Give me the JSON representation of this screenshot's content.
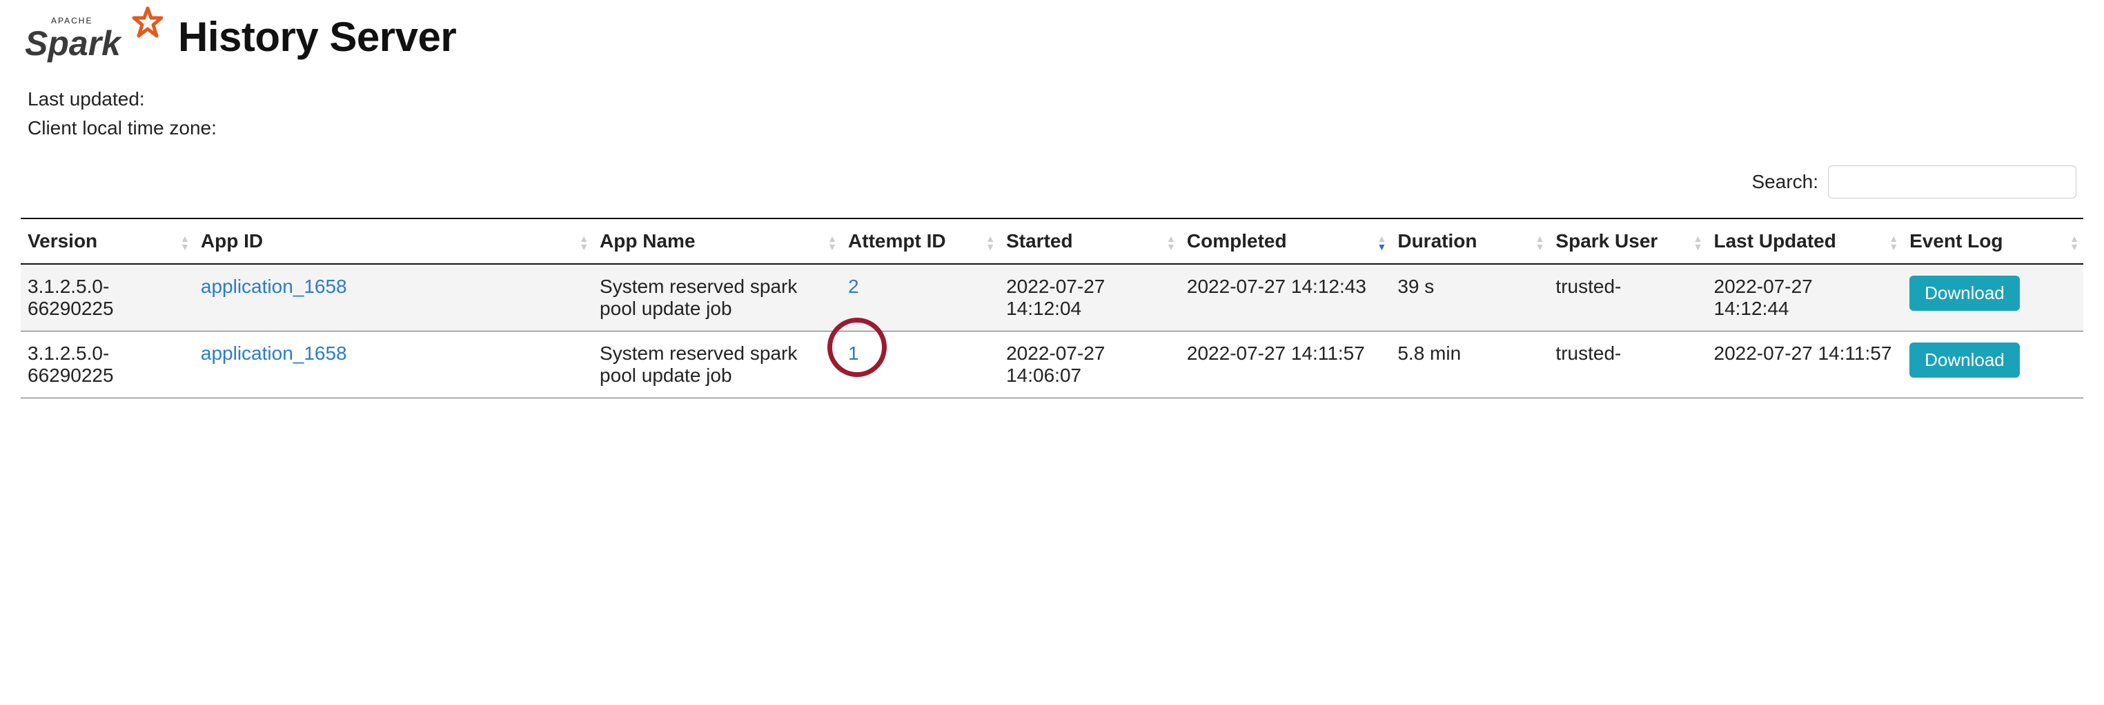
{
  "header": {
    "title": "History Server",
    "logo_alt": "Apache Spark"
  },
  "meta": {
    "last_updated_label": "Last updated:",
    "last_updated_value": "",
    "tz_label": "Client local time zone:",
    "tz_value": ""
  },
  "search": {
    "label": "Search:",
    "value": ""
  },
  "columns": {
    "version": "Version",
    "app_id": "App ID",
    "app_name": "App Name",
    "attempt_id": "Attempt ID",
    "started": "Started",
    "completed": "Completed",
    "duration": "Duration",
    "spark_user": "Spark User",
    "last_updated": "Last Updated",
    "event_log": "Event Log"
  },
  "download_label": "Download",
  "rows": [
    {
      "version": "3.1.2.5.0-66290225",
      "app_id": "application_1658",
      "app_name": "System reserved spark pool update job",
      "attempt_id": "2",
      "attempt_circled": false,
      "started": "2022-07-27 14:12:04",
      "completed": "2022-07-27 14:12:43",
      "duration": "39 s",
      "spark_user": "trusted-",
      "last_updated": "2022-07-27 14:12:44"
    },
    {
      "version": "3.1.2.5.0-66290225",
      "app_id": "application_1658",
      "app_name": "System reserved spark pool update job",
      "attempt_id": "1",
      "attempt_circled": true,
      "started": "2022-07-27 14:06:07",
      "completed": "2022-07-27 14:11:57",
      "duration": "5.8 min",
      "spark_user": "trusted-",
      "last_updated": "2022-07-27 14:11:57"
    }
  ],
  "sort": {
    "column": "completed",
    "direction": "desc"
  }
}
